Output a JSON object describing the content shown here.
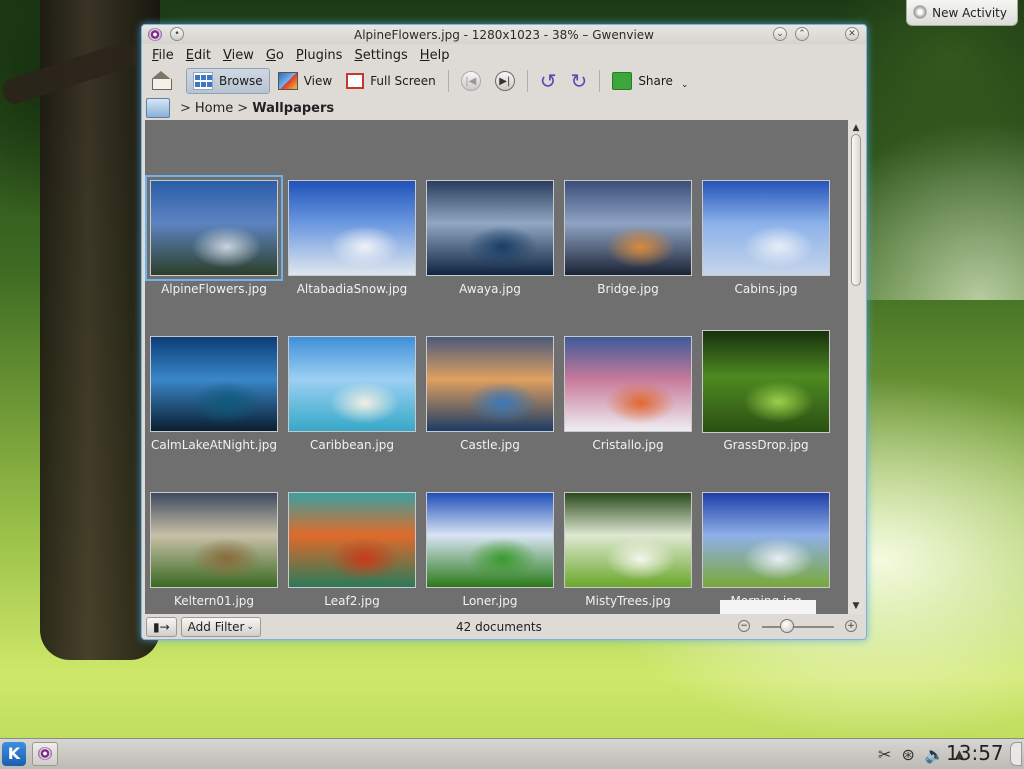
{
  "desktop": {
    "new_activity_label": "New Activity"
  },
  "window": {
    "title": "AlpineFlowers.jpg - 1280x1023 - 38% – Gwenview",
    "menu": [
      {
        "label": "File",
        "key": "F",
        "rest": "ile"
      },
      {
        "label": "Edit",
        "key": "E",
        "rest": "dit"
      },
      {
        "label": "View",
        "key": "V",
        "rest": "iew"
      },
      {
        "label": "Go",
        "key": "G",
        "rest": "o"
      },
      {
        "label": "Plugins",
        "key": "P",
        "rest": "lugins"
      },
      {
        "label": "Settings",
        "key": "S",
        "rest": "ettings"
      },
      {
        "label": "Help",
        "key": "H",
        "rest": "elp"
      }
    ],
    "toolbar": {
      "browse": "Browse",
      "view": "View",
      "full_screen": "Full Screen",
      "share": "Share"
    },
    "breadcrumb": {
      "home": "Home",
      "folder": "Wallpapers"
    },
    "thumbnails": [
      {
        "name": "AlpineFlowers.jpg",
        "selected": true,
        "colors": [
          "#2b5da8",
          "#5d84c0",
          "#c9d3dd",
          "#2c3f2a"
        ]
      },
      {
        "name": "AltabadiaSnow.jpg",
        "colors": [
          "#1f52b8",
          "#6b98e0",
          "#f0f3f7",
          "#dfe6ee"
        ]
      },
      {
        "name": "Awaya.jpg",
        "colors": [
          "#2a3d5c",
          "#90a8c4",
          "#1a3e66",
          "#0f2440"
        ]
      },
      {
        "name": "Bridge.jpg",
        "colors": [
          "#3b4e78",
          "#8fa3c4",
          "#d98a3a",
          "#1c2436"
        ]
      },
      {
        "name": "Cabins.jpg",
        "colors": [
          "#2554b8",
          "#8bb1ea",
          "#e8eef8",
          "#c6d5ea"
        ]
      },
      {
        "name": "CalmLakeAtNight.jpg",
        "colors": [
          "#0c3d78",
          "#3a86c8",
          "#0e5a7a",
          "#0a1e30"
        ]
      },
      {
        "name": "Caribbean.jpg",
        "colors": [
          "#3f8fd8",
          "#9cd0f2",
          "#f2efe4",
          "#36a8c8"
        ]
      },
      {
        "name": "Castle.jpg",
        "colors": [
          "#4a5a7c",
          "#e0a060",
          "#3a78b8",
          "#1b3b66"
        ]
      },
      {
        "name": "Cristallo.jpg",
        "colors": [
          "#3f5a9a",
          "#c87a9a",
          "#e06830",
          "#eeeef2"
        ]
      },
      {
        "name": "GrassDrop.jpg",
        "colors": [
          "#16300c",
          "#4e8a22",
          "#9cd04a",
          "#2a5012"
        ]
      },
      {
        "name": "Keltern01.jpg",
        "colors": [
          "#3e4a5e",
          "#c8c0a8",
          "#8a6a3a",
          "#3a6a22"
        ]
      },
      {
        "name": "Leaf2.jpg",
        "colors": [
          "#3aa0a0",
          "#e06a2a",
          "#c83a1a",
          "#2a7a5a"
        ]
      },
      {
        "name": "Loner.jpg",
        "colors": [
          "#1f4fb8",
          "#d8e4f4",
          "#3a9a2a",
          "#2a7a1a"
        ]
      },
      {
        "name": "MistyTrees.jpg",
        "colors": [
          "#2a4a1c",
          "#dfe8d2",
          "#f4f6ee",
          "#6aa82a"
        ]
      },
      {
        "name": "Morning.jpg",
        "colors": [
          "#1e3ea8",
          "#8fb0e8",
          "#e8eef6",
          "#7aa83a"
        ]
      }
    ],
    "status": {
      "toggle_label": "▮→",
      "add_filter": "Add Filter",
      "document_count": "42 documents",
      "zoom_fraction": 0.35
    }
  },
  "taskbar": {
    "clock": "13:57"
  }
}
